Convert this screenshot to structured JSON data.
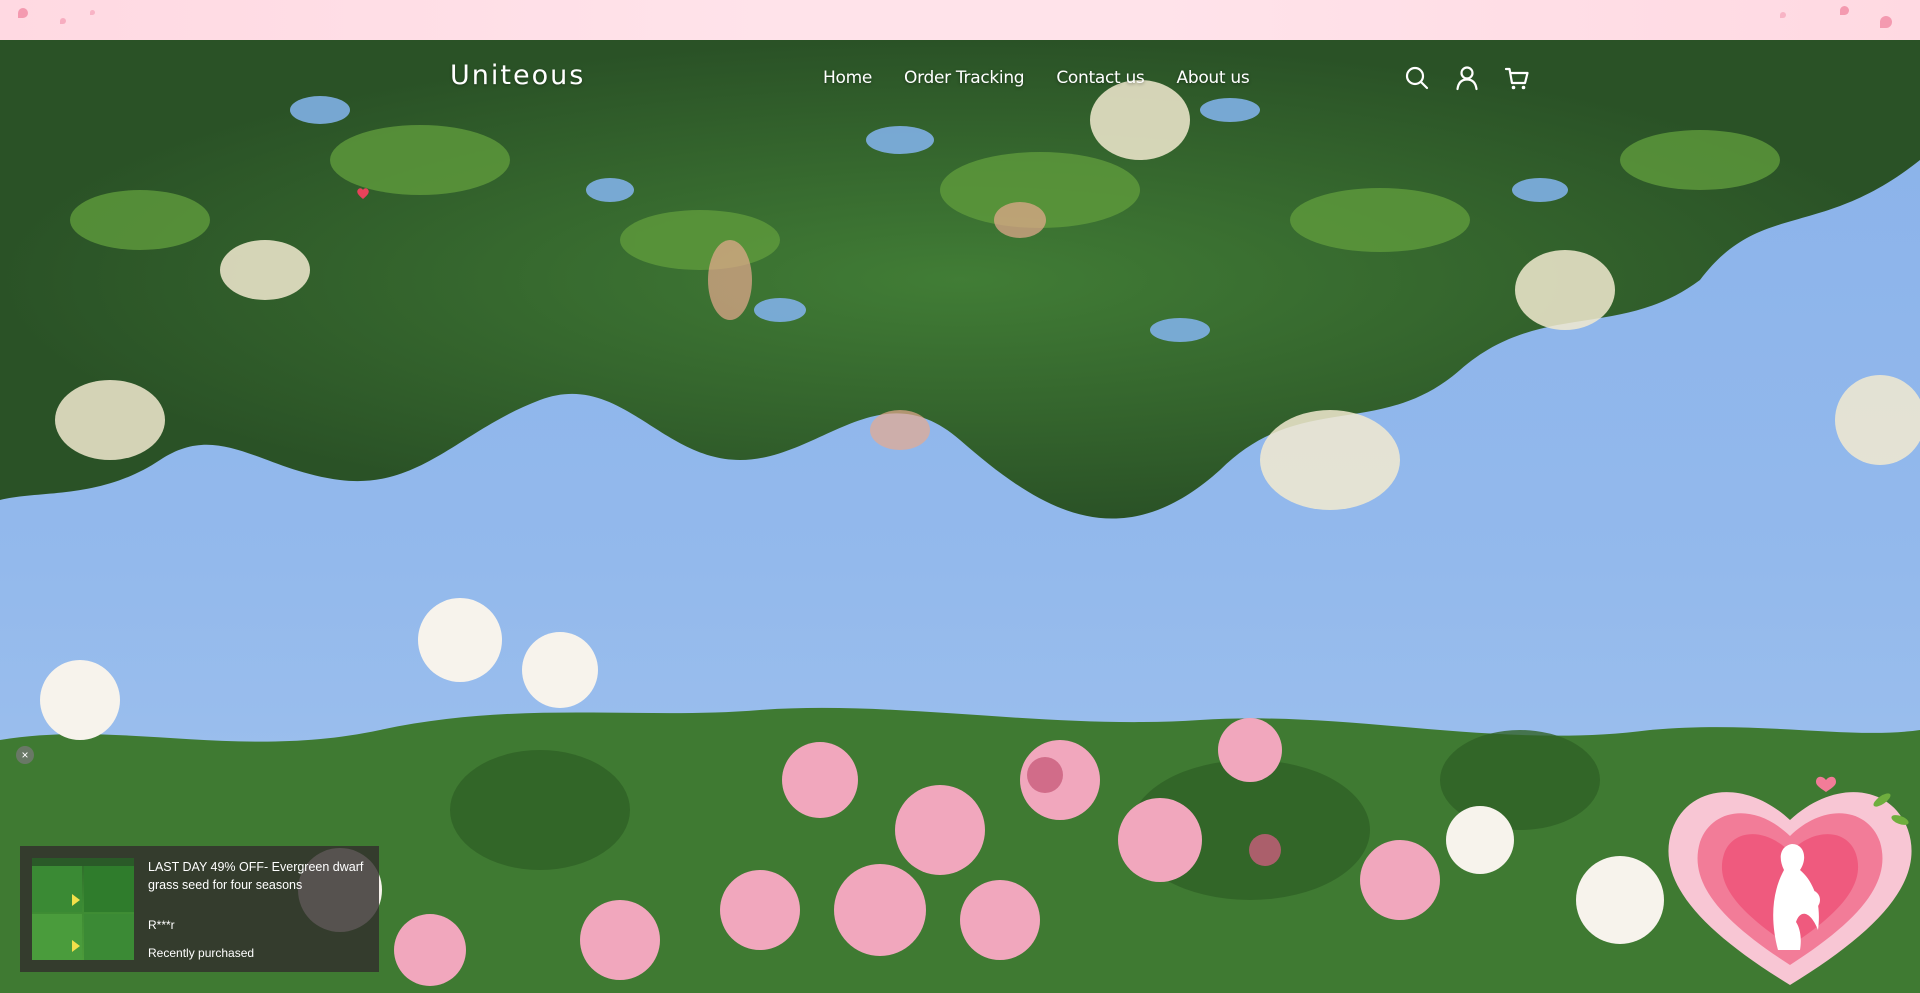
{
  "store": {
    "name": "Uniteous"
  },
  "nav": {
    "items": [
      {
        "label": "Home"
      },
      {
        "label": "Order Tracking"
      },
      {
        "label": "Contact us"
      },
      {
        "label": "About us"
      }
    ]
  },
  "header_icons": [
    "search-icon",
    "account-icon",
    "cart-icon"
  ],
  "popup": {
    "title": "LAST DAY 49% OFF- Evergreen dwarf grass seed for four seasons",
    "buyer": "R***r",
    "status": "Recently purchased",
    "close_glyph": "×"
  },
  "colors": {
    "announcement_bar": "#ffe3ea",
    "sky": "#8fb4e8",
    "popup_bg": "#322e2c",
    "nav_text": "#ffffff"
  }
}
